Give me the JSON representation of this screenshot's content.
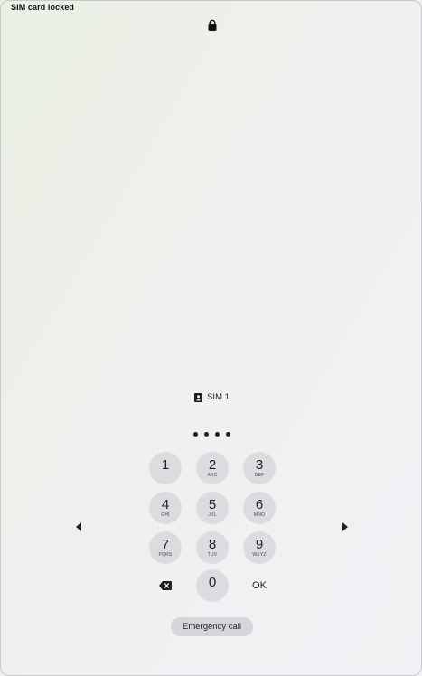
{
  "status_bar": {
    "text": "SIM card locked"
  },
  "header": {
    "lock_icon": "lock-icon"
  },
  "sim": {
    "icon": "sim-card-icon",
    "label": "SIM 1"
  },
  "pin": {
    "entered_count": 4
  },
  "keypad": {
    "keys": [
      {
        "digit": "1",
        "letters": ""
      },
      {
        "digit": "2",
        "letters": "ABC"
      },
      {
        "digit": "3",
        "letters": "DEF"
      },
      {
        "digit": "4",
        "letters": "GHI"
      },
      {
        "digit": "5",
        "letters": "JKL"
      },
      {
        "digit": "6",
        "letters": "MNO"
      },
      {
        "digit": "7",
        "letters": "PQRS"
      },
      {
        "digit": "8",
        "letters": "TUV"
      },
      {
        "digit": "9",
        "letters": "WXYZ"
      },
      {
        "digit": "0",
        "letters": ""
      }
    ],
    "backspace_icon": "backspace-icon",
    "ok_label": "OK"
  },
  "navigation": {
    "left_icon": "chevron-left-icon",
    "right_icon": "chevron-right-icon"
  },
  "emergency": {
    "label": "Emergency call"
  }
}
